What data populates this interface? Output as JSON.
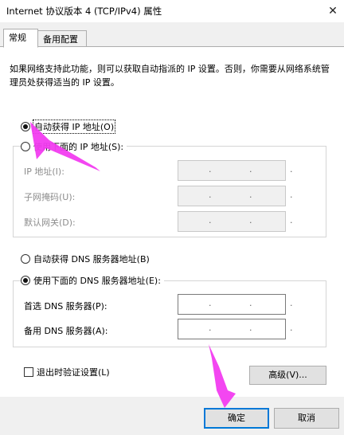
{
  "window": {
    "title": "Internet 协议版本 4 (TCP/IPv4) 属性",
    "close_glyph": "✕"
  },
  "tabs": [
    {
      "label": "常规",
      "active": true
    },
    {
      "label": "备用配置",
      "active": false
    }
  ],
  "description": "如果网络支持此功能，则可以获取自动指派的 IP 设置。否则，你需要从网络系统管理员处获得适当的 IP 设置。",
  "ip_section": {
    "auto_label": "自动获得 IP 地址(O)",
    "manual_label": "使用下面的 IP 地址(S):",
    "selected": "auto",
    "fields": [
      {
        "label": "IP 地址(I):",
        "value": ". . ."
      },
      {
        "label": "子网掩码(U):",
        "value": ". . ."
      },
      {
        "label": "默认网关(D):",
        "value": ". . ."
      }
    ]
  },
  "dns_section": {
    "auto_label": "自动获得 DNS 服务器地址(B)",
    "manual_label": "使用下面的 DNS 服务器地址(E):",
    "selected": "manual",
    "fields": [
      {
        "label": "首选 DNS 服务器(P):",
        "value": ". . ."
      },
      {
        "label": "备用 DNS 服务器(A):",
        "value": ". . ."
      }
    ]
  },
  "validate_checkbox": {
    "label": "退出时验证设置(L)",
    "checked": false
  },
  "buttons": {
    "advanced": "高级(V)...",
    "ok": "确定",
    "cancel": "取消"
  },
  "colors": {
    "accent": "#0078d7",
    "annotation_arrow": "#f23cf0"
  }
}
